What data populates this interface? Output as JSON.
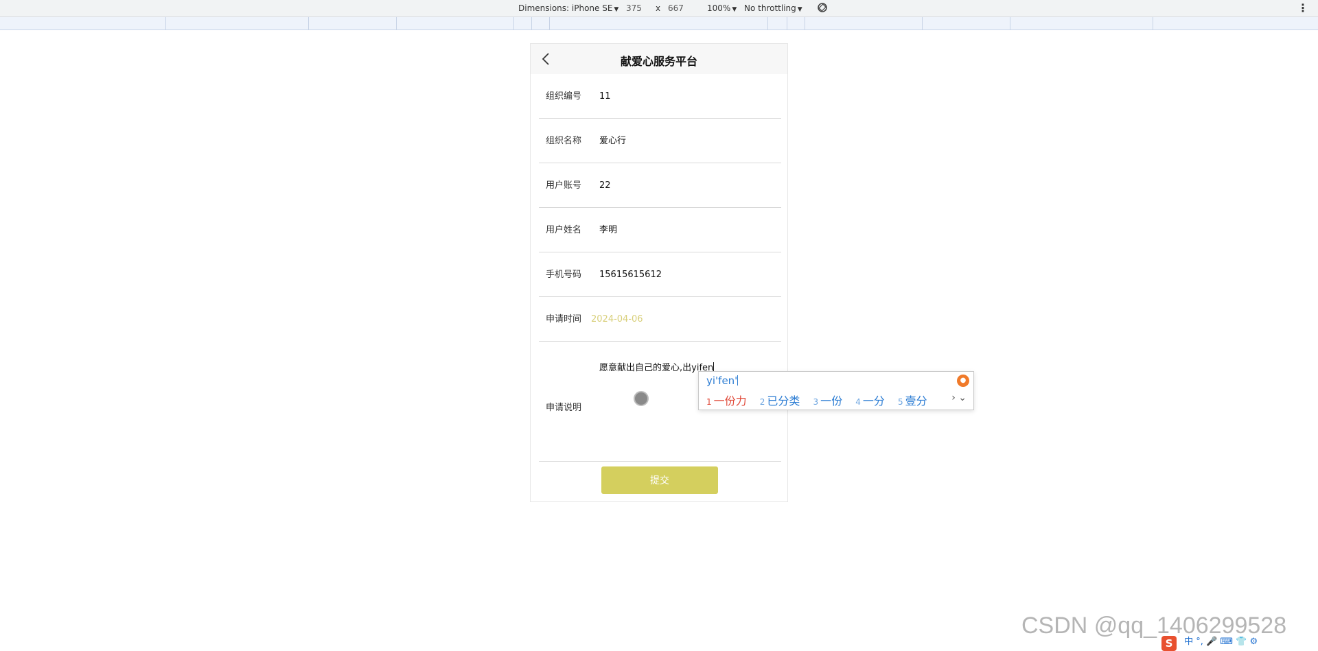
{
  "devtools": {
    "dimensions_label": "Dimensions: iPhone SE",
    "width": "375",
    "times": "x",
    "height": "667",
    "zoom": "100%",
    "throttling": "No throttling"
  },
  "app": {
    "title": "献爱心服务平台",
    "fields": [
      {
        "label": "组织编号",
        "value": "11"
      },
      {
        "label": "组织名称",
        "value": "爱心行"
      },
      {
        "label": "用户账号",
        "value": "22"
      },
      {
        "label": "用户姓名",
        "value": "李明"
      },
      {
        "label": "手机号码",
        "value": "15615615612"
      },
      {
        "label": "申请时间",
        "value": "2024-04-06"
      }
    ],
    "description": {
      "label": "申请说明",
      "value": "愿意献出自己的爱心,出yifen"
    },
    "submit_label": "提交"
  },
  "ime": {
    "pinyin": "yi'fen'",
    "candidates": [
      {
        "num": "1",
        "text": "一份力"
      },
      {
        "num": "2",
        "text": "已分类"
      },
      {
        "num": "3",
        "text": "一份"
      },
      {
        "num": "4",
        "text": "一分"
      },
      {
        "num": "5",
        "text": "壹分"
      }
    ],
    "pager": "› ⌄"
  },
  "watermark": "CSDN @qq_1406299528",
  "tray": {
    "badge": "S",
    "icons": "中 °, 🎤 ⌨ 👕 ⚙"
  },
  "colors": {
    "accent": "#d4cf5e",
    "date": "#d8cf7a",
    "ime_blue": "#2b7cd3",
    "ime_red": "#e04a3a"
  }
}
